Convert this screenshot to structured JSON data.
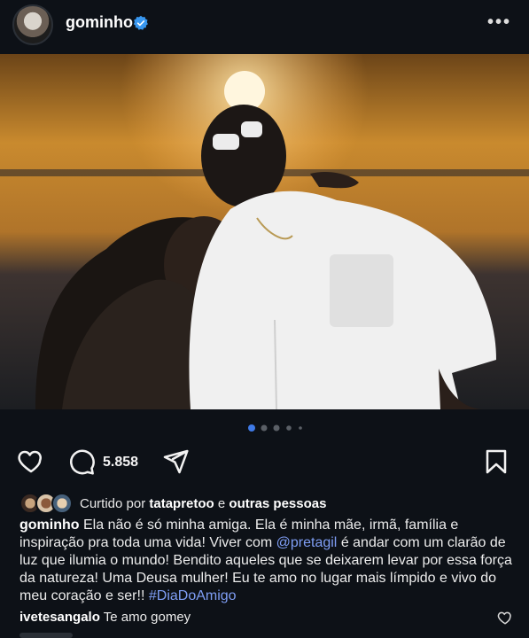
{
  "post": {
    "username": "gominho",
    "verified": true,
    "more_icon": "more-horizontal-icon"
  },
  "carousel": {
    "count": 5,
    "active_index": 0,
    "active_color": "#3f7ae6"
  },
  "actions": {
    "like_icon": "heart-outline-icon",
    "comment_icon": "comment-bubble-icon",
    "comment_count": "5.858",
    "share_icon": "paper-plane-icon",
    "save_icon": "bookmark-icon"
  },
  "likes": {
    "prefix": "Curtido por",
    "user": "tatapretoo",
    "connector": "e",
    "suffix": "outras pessoas"
  },
  "caption": {
    "username": "gominho",
    "part1": "Ela não é só minha amiga. Ela é minha mãe, irmã, família e inspiração pra toda uma vida! Viver com",
    "mention": "@pretagil",
    "part2": "é andar com um clarão de luz que ilumia o mundo! Bendito aqueles que se deixarem levar por essa força da natureza! Uma Deusa mulher! Eu te amo no lugar mais límpido e vivo do meu coração e ser!!",
    "hashtag": "#DiaDoAmigo"
  },
  "comment": {
    "username": "ivetesangalo",
    "text": "Te amo gomey"
  },
  "colors": {
    "background": "#0d1117",
    "link": "#7f9ef5",
    "verified": "#3897f0"
  }
}
